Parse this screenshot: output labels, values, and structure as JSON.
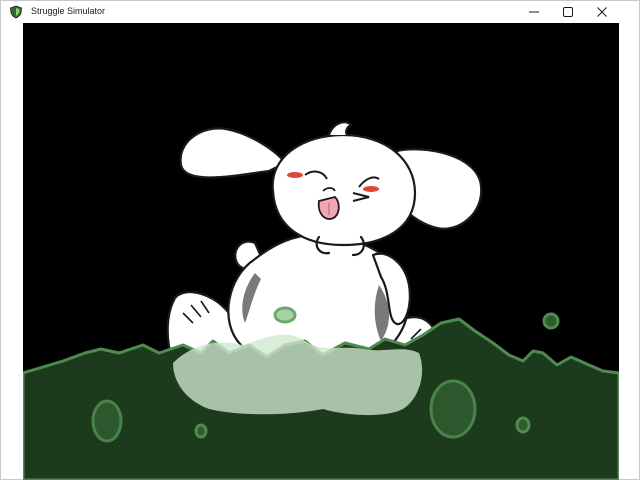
{
  "window": {
    "title": "Struggle Simulator",
    "icon": "app-shield-icon",
    "controls": [
      "minimize-icon",
      "maximize-icon",
      "close-icon"
    ]
  },
  "scene": {
    "background_color": "#000000",
    "slime_color": "#1c3a1c",
    "slime_outline_color": "#4f8a4f",
    "character_color": "#ffffff"
  }
}
